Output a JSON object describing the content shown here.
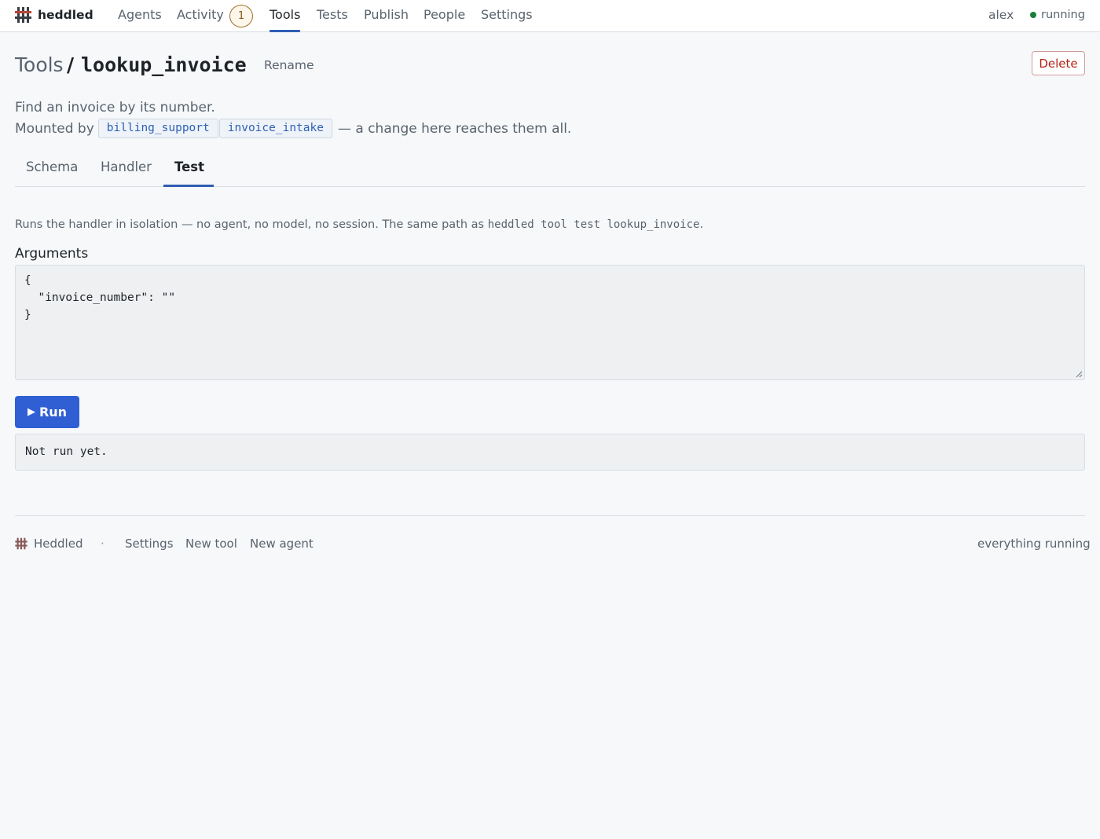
{
  "app": {
    "name": "heddled"
  },
  "nav": {
    "items": [
      {
        "label": "Agents"
      },
      {
        "label": "Activity"
      },
      {
        "label": "Tools"
      },
      {
        "label": "Tests"
      },
      {
        "label": "Publish"
      },
      {
        "label": "People"
      },
      {
        "label": "Settings"
      }
    ],
    "active": "Tools",
    "activity_badge": "1",
    "user": "alex",
    "status": "running"
  },
  "header": {
    "breadcrumb_parent": "Tools",
    "separator": "/",
    "tool_name": "lookup_invoice",
    "rename_label": "Rename",
    "delete_label": "Delete"
  },
  "description": "Find an invoice by its number.",
  "mounted": {
    "label": "Mounted by",
    "agents": [
      "billing_support",
      "invoice_intake"
    ],
    "tail": "— a change here reaches them all."
  },
  "tabs": {
    "items": [
      "Schema",
      "Handler",
      "Test"
    ],
    "active": "Test"
  },
  "test": {
    "note_prefix": "Runs the handler in isolation — no agent, no model, no session. The same path as ",
    "note_cmd": "heddled tool test lookup_invoice",
    "note_suffix": ".",
    "arguments_label": "Arguments",
    "arguments_value": "{\n  \"invoice_number\": \"\"\n}",
    "run_icon": "▶",
    "run_label": "Run",
    "output": "Not run yet."
  },
  "footer": {
    "brand": "Heddled",
    "separator": "·",
    "links": [
      "Settings",
      "New tool",
      "New agent"
    ],
    "status": "everything running"
  },
  "colors": {
    "accent": "#2f5fb3",
    "run_button": "#2f5fd3",
    "danger": "#b42318",
    "status_ok": "#1a7f37",
    "badge_border": "#a0702a"
  }
}
